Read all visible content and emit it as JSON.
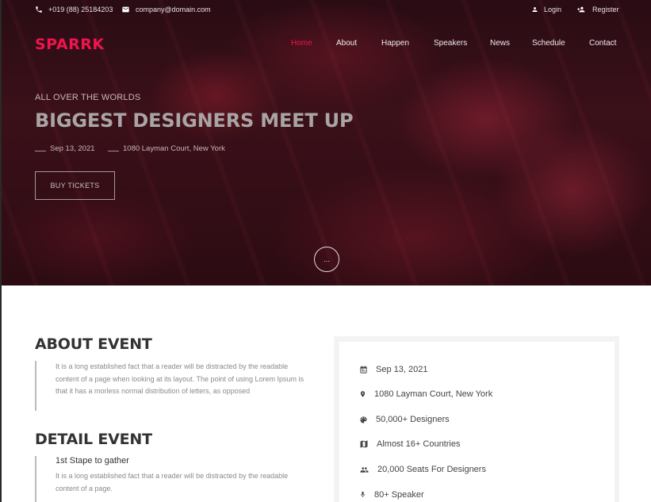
{
  "topbar": {
    "phone": "+019 (88) 25184203",
    "email": "company@domain.com",
    "login": "Login",
    "register": "Register"
  },
  "brand": {
    "logo": "SPARRK",
    "accent": "#f0144e"
  },
  "nav": {
    "items": [
      "Home",
      "About",
      "Happen",
      "Speakers",
      "News",
      "Schedule",
      "Contact"
    ],
    "active": "Home"
  },
  "hero": {
    "kicker": "ALL OVER THE WORLDS",
    "headline": "BIGGEST DESIGNERS MEET UP",
    "date": "Sep 13, 2021",
    "location": "1080 Layman Court, New York",
    "cta": "BUY TICKETS",
    "scroll_label": "..."
  },
  "about": {
    "title": "ABOUT EVENT",
    "text": "It is a long established fact that a reader will be distracted by the readable content of a page when looking at its layout. The point of using Lorem Ipsum is that it has a morless normal distribution of letters, as opposed"
  },
  "detail": {
    "title": "DETAIL EVENT",
    "step_title": "1st Stape to gather",
    "step_text": "It is a long established fact that a reader will be distracted by the readable content of a page."
  },
  "info": [
    {
      "icon": "calendar-icon",
      "text": "Sep 13, 2021"
    },
    {
      "icon": "location-pin-icon",
      "text": "1080 Layman Court, New York"
    },
    {
      "icon": "palette-icon",
      "text": "50,000+ Designers"
    },
    {
      "icon": "map-icon",
      "text": "Almost 16+ Countries"
    },
    {
      "icon": "people-icon",
      "text": "20,000 Seats For Designers"
    },
    {
      "icon": "microphone-icon",
      "text": "80+ Speaker"
    }
  ]
}
